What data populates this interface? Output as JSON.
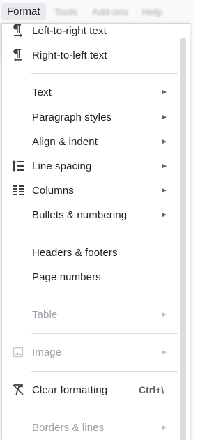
{
  "menubar": {
    "active_menu": "Format",
    "ghost_items": [
      "Tools",
      "Add-ons",
      "Help"
    ]
  },
  "format_menu": {
    "items": [
      {
        "label": "Left-to-right text",
        "icon": "ltr-text-icon"
      },
      {
        "label": "Right-to-left text",
        "icon": "rtl-text-icon"
      },
      {
        "label": "Text",
        "submenu": true
      },
      {
        "label": "Paragraph styles",
        "submenu": true
      },
      {
        "label": "Align & indent",
        "submenu": true
      },
      {
        "label": "Line spacing",
        "submenu": true,
        "icon": "line-spacing-icon"
      },
      {
        "label": "Columns",
        "submenu": true,
        "icon": "columns-icon"
      },
      {
        "label": "Bullets & numbering",
        "submenu": true
      },
      {
        "label": "Headers & footers"
      },
      {
        "label": "Page numbers"
      },
      {
        "label": "Table",
        "submenu": true,
        "disabled": true
      },
      {
        "label": "Image",
        "submenu": true,
        "disabled": true,
        "icon": "image-icon"
      },
      {
        "label": "Clear formatting",
        "shortcut": "Ctrl+\\",
        "icon": "clear-formatting-icon"
      },
      {
        "label": "Borders & lines",
        "submenu": true,
        "disabled": true
      }
    ],
    "submenu_arrow": "►"
  },
  "colors": {
    "text": "#202124",
    "disabled_text": "#9aa0a6",
    "separator": "#dadce0",
    "menubar_bg": "#f8f9fa"
  }
}
